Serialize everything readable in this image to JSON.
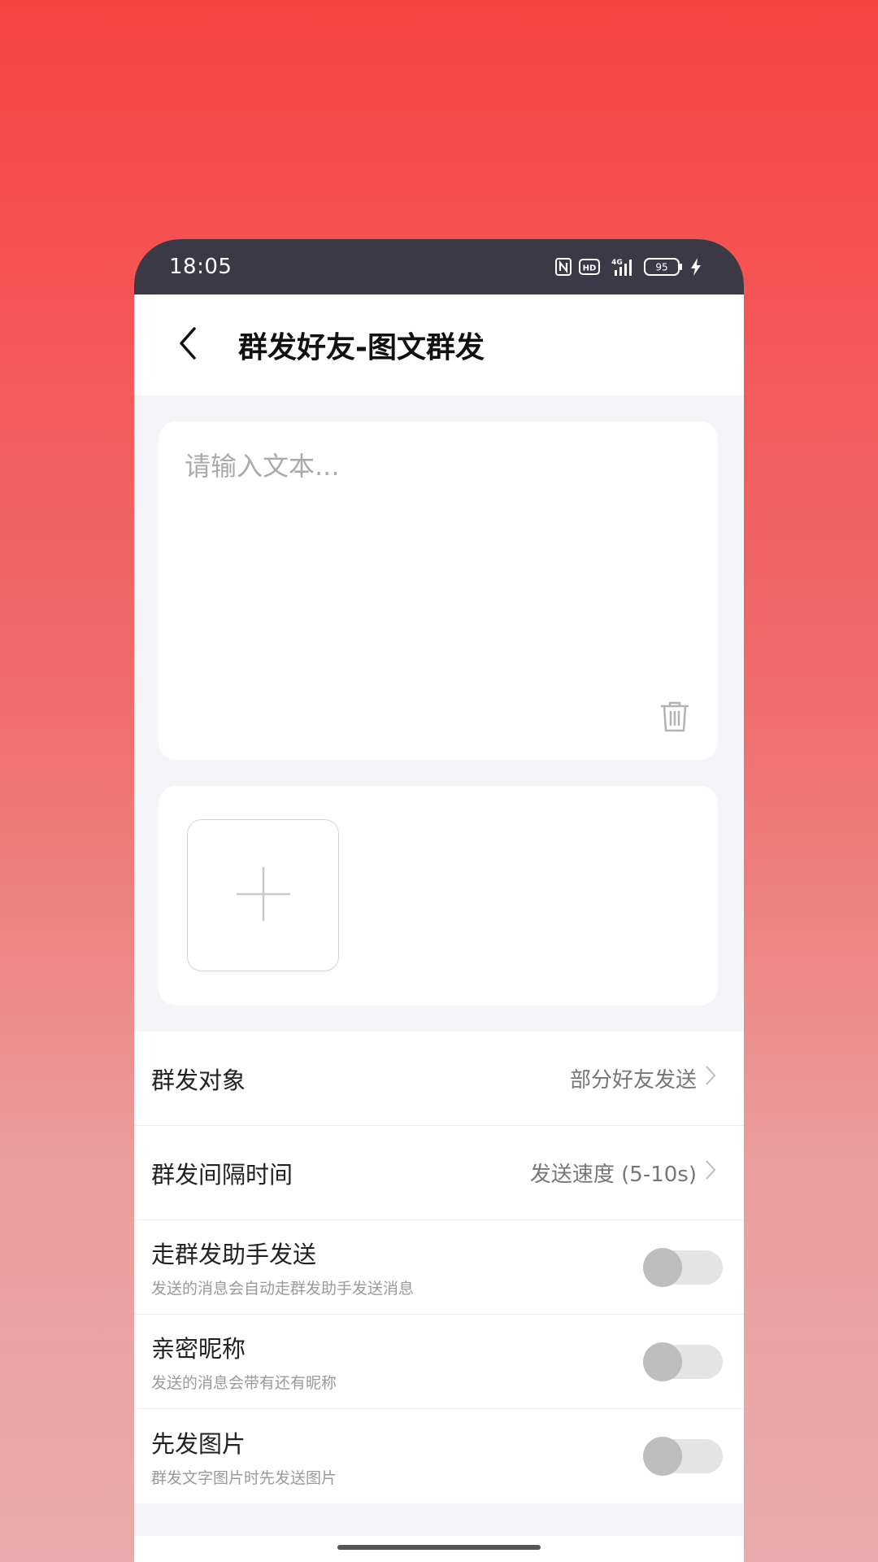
{
  "status_bar": {
    "time": "18:05",
    "hd_label": "HD",
    "network_label": "4G",
    "battery": "95",
    "icons": [
      "nfc-icon",
      "hd-icon",
      "signal-icon",
      "battery-icon",
      "charging-icon"
    ]
  },
  "header": {
    "title": "群发好友-图文群发",
    "back_icon": "chevron-left-icon"
  },
  "message": {
    "placeholder": "请输入文本...",
    "value": "",
    "delete_icon": "trash-icon"
  },
  "images": {
    "add_icon": "plus-icon"
  },
  "settings": {
    "target": {
      "label": "群发对象",
      "value": "部分好友发送"
    },
    "interval": {
      "label": "群发间隔时间",
      "value": "发送速度 (5-10s)"
    },
    "assistant": {
      "label": "走群发助手发送",
      "desc": "发送的消息会自动走群发助手发送消息",
      "enabled": false
    },
    "nickname": {
      "label": "亲密昵称",
      "desc": "发送的消息会带有还有昵称",
      "enabled": false
    },
    "image_first": {
      "label": "先发图片",
      "desc": "群发文字图片时先发送图片",
      "enabled": false
    }
  },
  "colors": {
    "status_bar_bg": "#3b3945",
    "toggle_off_track": "#e4e4e4",
    "toggle_off_knob": "#bdbdbd",
    "page_bg": "#f5f5f9"
  }
}
